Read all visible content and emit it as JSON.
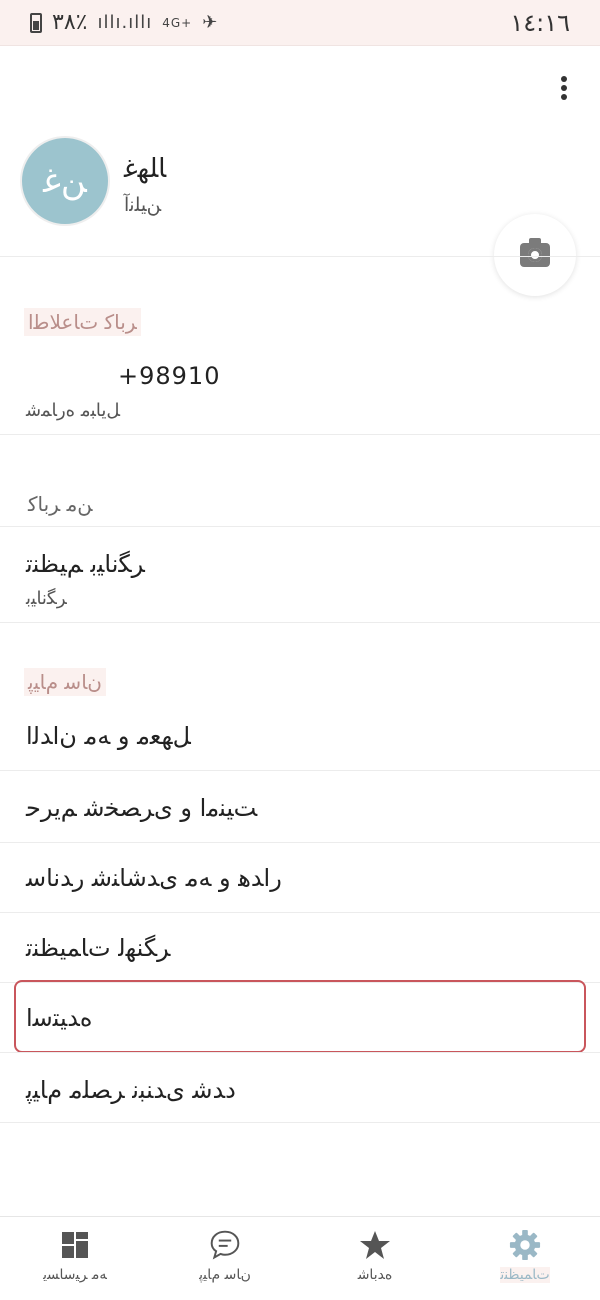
{
  "status_bar": {
    "battery_text": "٣٨٪",
    "network": "4G+",
    "time": "١٤:١٦"
  },
  "profile": {
    "avatar_initials": "ﻦﻏ",
    "name": "ﺎﻠﮭﻏ",
    "status": "ﻦﯿﻠﻧﺁ"
  },
  "sections": {
    "account": {
      "title": "ﺮﺑﺎﮐ ﺕﺎﻋﻼﻃﺍ",
      "phone": "+98910",
      "phone_label": "ﻞﯾﺎﺒﻣ ﻩﺭﺎﻤﺷ"
    },
    "user_section": {
      "title": "ﻦﻣ ﺮﺑﺎﮐ",
      "item_title": "ﺮﮕﻧﺎﯿﺑ ﻢﯿﻈﻨﺗ",
      "item_sub": "ﺮﮕﻧﺎﯿﺑ"
    },
    "app": {
      "title": "ﻥﺎﺳ ﻡﺎﯿﭘ",
      "items": [
        "ﻞﻬﻌﻣ ﻭ ﻪﻣ ﻥﺍﺪﻟﺍ",
        "ﺖﯿﻨﻣﺍ ﻭ ﯼﺮﺼﺨﺷ ﻢﯾﺮﺣ",
        "ﺭﺍﺪﻫ ﻭ ﻪﻣ ﯼﺪﺷﺎﻨﺷ ﺭﺪﻧﺎﺳ",
        "ﺮﮕﻨﻬﻟ ﺕﺎﻤﯿﻈﻨﺗ",
        "ﻩﺪﯿﺘﺳﺍ",
        "ﺩﺪﺷ ﯼﺪﻨﺒﻧ ﺮﺼﻠﻣ ﻡﺎﯿﭘ"
      ]
    }
  },
  "bottom_nav": [
    {
      "label": "ﻪﻣ ﺮﯿﺳﺎﺴﯾ",
      "icon": "dashboard-icon"
    },
    {
      "label": "ﻥﺎﺳ ﻡﺎﯿﭘ",
      "icon": "chat-icon"
    },
    {
      "label": "ﻩﺪﺑﺎﺷ",
      "icon": "star-icon"
    },
    {
      "label": "ﺕﺎﻤﯿﻈﻨﺗ",
      "icon": "gear-icon",
      "active": true
    }
  ],
  "colors": {
    "accent": "#9ab8c6",
    "avatar_bg": "#9cc4ce",
    "highlight": "#c9565c",
    "status_bar_bg": "#fbf1ef"
  }
}
